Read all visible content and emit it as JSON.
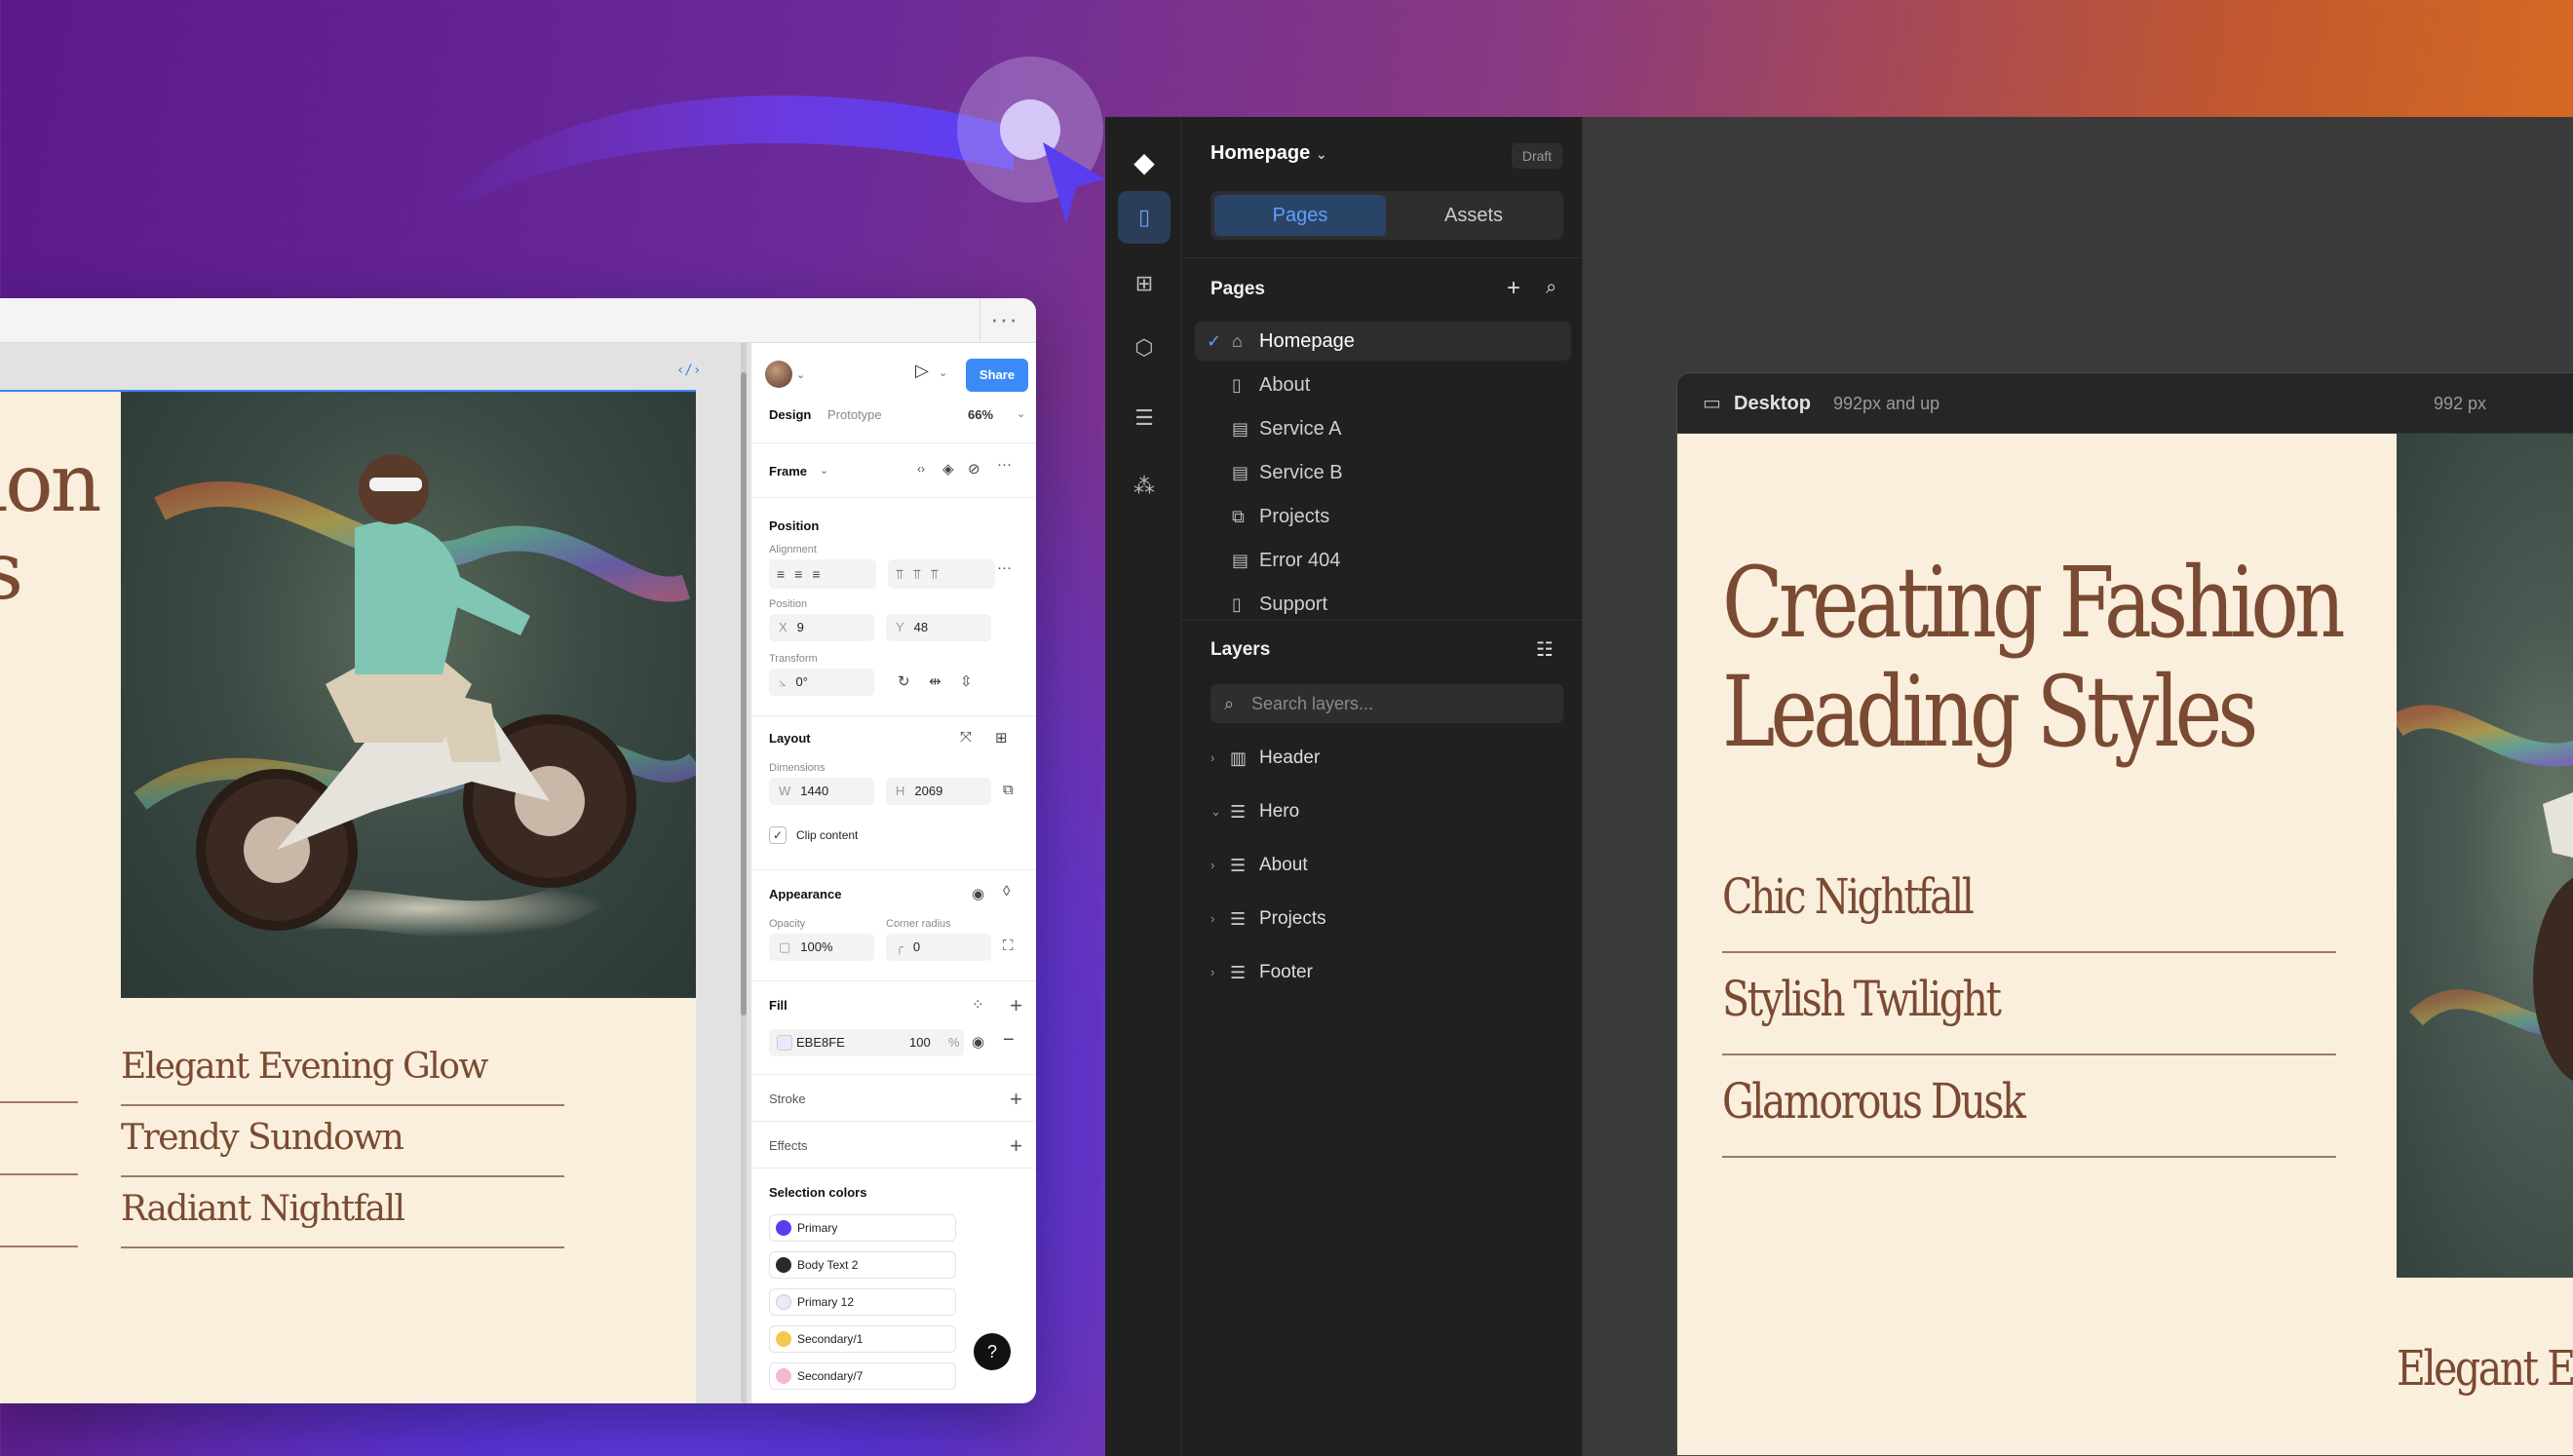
{
  "colors": {
    "accent": "#3b8bf6",
    "artboard_bg": "#faeedd",
    "heading_brown": "#7a4a32",
    "dark_panel": "#202020"
  },
  "design_app": {
    "toolbar_more_icon": "more-horizontal-icon",
    "artboard": {
      "hero_partial": [
        "ion",
        "s"
      ],
      "list_items": [
        "Elegant Evening Glow",
        "Trendy Sundown",
        "Radiant Nightfall"
      ]
    },
    "panel": {
      "share_label": "Share",
      "tabs": [
        "Design",
        "Prototype"
      ],
      "zoom": "66%",
      "frame_label": "Frame",
      "position_heading": "Position",
      "alignment_label": "Alignment",
      "position_label": "Position",
      "x_label": "X",
      "x_value": "9",
      "y_label": "Y",
      "y_value": "48",
      "transform_label": "Transform",
      "rotation_value": "0°",
      "layout_heading": "Layout",
      "dimensions_label": "Dimensions",
      "w_label": "W",
      "w_value": "1440",
      "h_label": "H",
      "h_value": "2069",
      "clip_content_label": "Clip content",
      "appearance_heading": "Appearance",
      "opacity_label": "Opacity",
      "opacity_value": "100%",
      "corner_radius_label": "Corner radius",
      "corner_radius_value": "0",
      "fill_heading": "Fill",
      "fill_hex": "EBE8FE",
      "fill_opacity": "100",
      "fill_percent": "%",
      "stroke_heading": "Stroke",
      "effects_heading": "Effects",
      "selection_colors_heading": "Selection colors",
      "selection_colors": [
        {
          "name": "Primary",
          "color": "#5b3df0"
        },
        {
          "name": "Body Text 2",
          "color": "#2a2a2a"
        },
        {
          "name": "Primary 12",
          "color": "#ebe8fe"
        },
        {
          "name": "Secondary/1",
          "color": "#f2c94c"
        },
        {
          "name": "Secondary/7",
          "color": "#f7b6d8"
        }
      ],
      "help_label": "?"
    }
  },
  "builder_app": {
    "rail_icons": [
      "logo-icon",
      "pages-icon",
      "add-section-icon",
      "components-icon",
      "database-icon",
      "apps-icon"
    ],
    "site_title": "Homepage",
    "status_badge": "Draft",
    "tabs": [
      "Pages",
      "Assets"
    ],
    "pages_heading": "Pages",
    "pages": [
      "Homepage",
      "About",
      "Service A",
      "Service B",
      "Projects",
      "Error 404",
      "Support"
    ],
    "layers_heading": "Layers",
    "search_placeholder": "Search layers...",
    "layers": [
      "Header",
      "Hero",
      "About",
      "Projects",
      "Footer"
    ],
    "preview": {
      "breakpoint": "Desktop",
      "breakpoint_range": "992px and up",
      "width_readout": "992 px",
      "hero_line1": "Creating Fashion",
      "hero_line2": "Leading Styles",
      "list_items": [
        "Chic Nightfall",
        "Stylish Twilight",
        "Glamorous Dusk"
      ],
      "bottom_text": "Elegant Ev"
    }
  }
}
